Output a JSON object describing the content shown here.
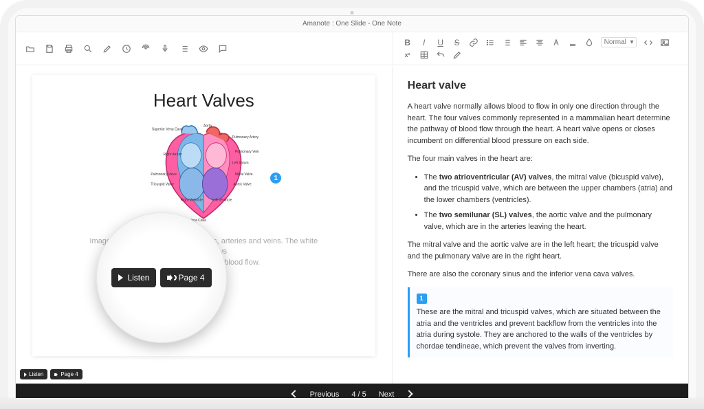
{
  "app_title": "Amanote : One Slide - One Note",
  "slide": {
    "title": "Heart Valves",
    "caption_line1": "Image of the heart showing the valves, arteries and veins. The white arrows shows",
    "caption_line2": "the normal direction of blood flow.",
    "ref_number": "1",
    "labels": {
      "svc": "Superior Vena Cava",
      "aorta": "Aorta",
      "pa": "Pulmonary Artery",
      "pv": "Pulmonary Vein",
      "ra": "Right Atrium",
      "la": "Left Atrium",
      "mv": "Mitral Valve",
      "av": "Aortic Valve",
      "pvlv": "Pulmonary Valve",
      "tv": "Tricuspid Valve",
      "rv": "Right Ventricle",
      "lv": "Left Ventricle",
      "ivc": "Inferior Vena Cava"
    }
  },
  "notes": {
    "heading": "Heart valve",
    "p1": "A heart valve normally allows blood to flow in only one direction through the heart. The four valves commonly represented in a mammalian heart determine the pathway of blood flow through the heart. A heart valve opens or closes incumbent on differential blood pressure on each side.",
    "p2": "The four main valves in the heart are:",
    "li1_a": "The ",
    "li1_b": "two atrioventricular (AV) valves",
    "li1_c": ", the mitral valve (bicuspid valve), and the tricuspid valve, which are between the upper chambers (atria) and the lower chambers (ventricles).",
    "li2_a": "The ",
    "li2_b": "two semilunar (SL) valves",
    "li2_c": ", the aortic valve and the pulmonary valve, which are in the arteries leaving the heart.",
    "p3": "The mitral valve and the aortic valve are in the left heart; the tricuspid valve and the pulmonary valve are in the right heart.",
    "p4": "There are also the coronary sinus and the inferior vena cava valves.",
    "ref_num": "1",
    "ref_text": "These are the mitral and tricuspid valves, which are situated between the atria and the ventricles and prevent backflow from the ventricles into the atria during systole. They are anchored to the walls of the ventricles by chordae tendineae, which prevent the valves from inverting."
  },
  "format_select": "Normal",
  "audio": {
    "listen_label": "Listen",
    "page_label": "Page 4"
  },
  "nav": {
    "prev": "Previous",
    "counter": "4 / 5",
    "next": "Next"
  }
}
